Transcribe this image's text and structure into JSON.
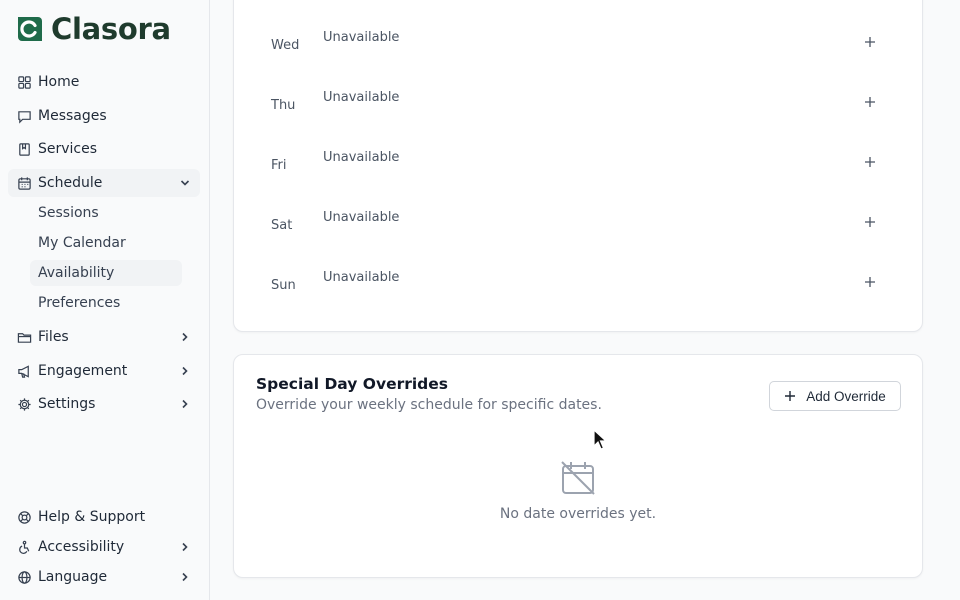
{
  "app": {
    "name": "Clasora",
    "brand_color": "#1f6b4a"
  },
  "sidebar": {
    "items": [
      {
        "label": "Home",
        "icon": "home-grid-icon"
      },
      {
        "label": "Messages",
        "icon": "message-icon"
      },
      {
        "label": "Services",
        "icon": "book-icon"
      },
      {
        "label": "Schedule",
        "icon": "calendar-icon",
        "expanded": true
      },
      {
        "label": "Files",
        "icon": "folder-icon"
      },
      {
        "label": "Engagement",
        "icon": "megaphone-icon"
      },
      {
        "label": "Settings",
        "icon": "gear-icon"
      }
    ],
    "schedule_sub": [
      {
        "label": "Sessions"
      },
      {
        "label": "My Calendar"
      },
      {
        "label": "Availability",
        "active": true
      },
      {
        "label": "Preferences"
      }
    ],
    "footer": [
      {
        "label": "Help & Support",
        "icon": "lifebuoy-icon"
      },
      {
        "label": "Accessibility",
        "icon": "accessibility-icon"
      },
      {
        "label": "Language",
        "icon": "globe-icon"
      }
    ]
  },
  "weekly": {
    "days": [
      {
        "day": "Wed",
        "status": "Unavailable"
      },
      {
        "day": "Thu",
        "status": "Unavailable"
      },
      {
        "day": "Fri",
        "status": "Unavailable"
      },
      {
        "day": "Sat",
        "status": "Unavailable"
      },
      {
        "day": "Sun",
        "status": "Unavailable"
      }
    ]
  },
  "overrides": {
    "title": "Special Day Overrides",
    "subtitle": "Override your weekly schedule for specific dates.",
    "add_label": "Add Override",
    "empty_text": "No date overrides yet."
  }
}
